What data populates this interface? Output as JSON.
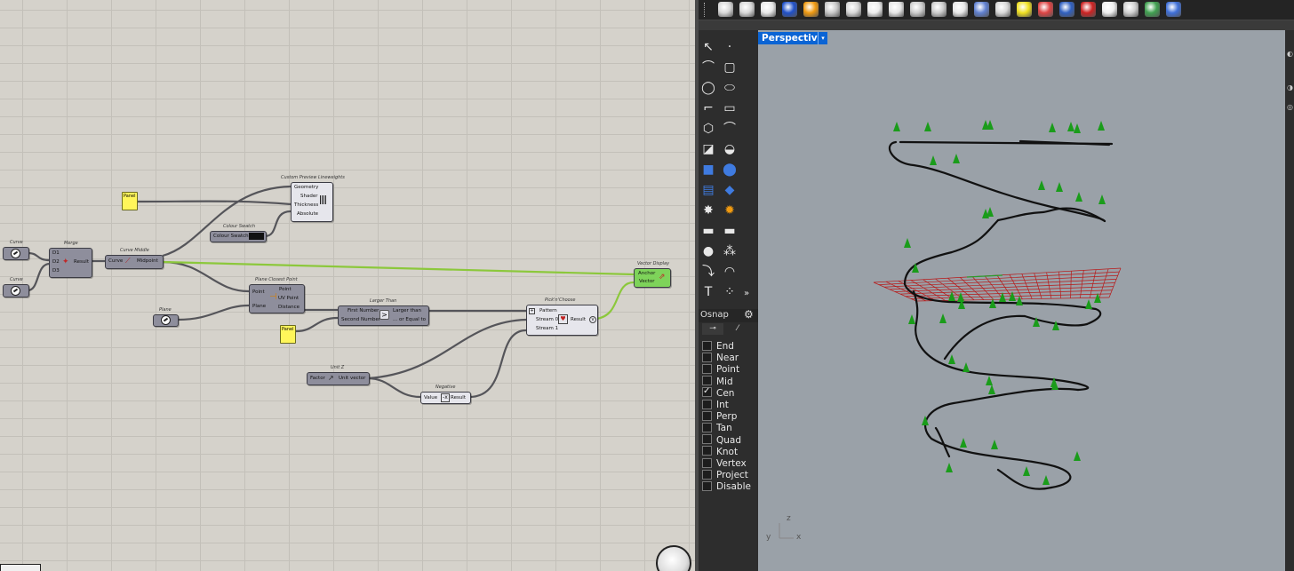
{
  "grasshopper": {
    "components": {
      "curve1": {
        "title": "Curve"
      },
      "curve2": {
        "title": "Curve"
      },
      "merge": {
        "title": "Merge",
        "inputs": [
          "D1",
          "D2",
          "D3"
        ],
        "output": "Result"
      },
      "curve_middle": {
        "title": "Curve Middle",
        "input": "Curve",
        "output": "Midpoint"
      },
      "custom_preview": {
        "title": "Custom Preview Lineweights",
        "inputs": [
          "Geometry",
          "Shader",
          "Thickness",
          "Absolute"
        ]
      },
      "colour_swatch": {
        "title": "Colour Swatch",
        "label": "Colour Swatch",
        "color": "#111111"
      },
      "panel_top": {
        "label": "Panel"
      },
      "vector_display": {
        "title": "Vector Display",
        "inputs": [
          "Anchor",
          "Vector"
        ]
      },
      "plane_closest": {
        "title": "Plane Closest Point",
        "inputs": [
          "Point",
          "Plane"
        ],
        "outputs": [
          "Point",
          "UV Point",
          "Distance"
        ]
      },
      "plane_param": {
        "title": "Plane"
      },
      "larger_than": {
        "title": "Larger Than",
        "inputs": [
          "First Number",
          "Second Number"
        ],
        "outputs": [
          "Larger than",
          "... or Equal to"
        ],
        "symbol": ">"
      },
      "panel_mid": {
        "label": "Panel"
      },
      "pick_choose": {
        "title": "Pick'n'Choose",
        "inputs": [
          "Pattern",
          "Stream 0",
          "Stream 1"
        ],
        "output": "Result"
      },
      "unit_z": {
        "title": "Unit Z",
        "input": "Factor",
        "output": "Unit vector"
      },
      "negative": {
        "title": "Negative",
        "input": "Value",
        "output": "Result"
      }
    },
    "colors": {
      "wire": "#55555a",
      "selected_wire": "#8cc83c",
      "vector_display": "#7ed35a",
      "panel": "#fff65a"
    }
  },
  "rhino": {
    "viewport": {
      "name": "Perspective",
      "background": "#9aa1a8"
    },
    "axes": {
      "z": "z",
      "y": "y",
      "x": "x"
    },
    "osnap": {
      "title": "Osnap",
      "items": [
        {
          "label": "End",
          "checked": false
        },
        {
          "label": "Near",
          "checked": false
        },
        {
          "label": "Point",
          "checked": false
        },
        {
          "label": "Mid",
          "checked": false
        },
        {
          "label": "Cen",
          "checked": true
        },
        {
          "label": "Int",
          "checked": false
        },
        {
          "label": "Perp",
          "checked": false
        },
        {
          "label": "Tan",
          "checked": false
        },
        {
          "label": "Quad",
          "checked": false
        },
        {
          "label": "Knot",
          "checked": false
        },
        {
          "label": "Vertex",
          "checked": false
        },
        {
          "label": "Project",
          "checked": false
        },
        {
          "label": "Disable",
          "checked": false
        }
      ]
    },
    "toolbar_icons": [
      "select-arrow-icon",
      "point-icon",
      "polyline-icon",
      "rectangle-icon",
      "circle-icon",
      "ellipse-icon",
      "arc-icon",
      "rect-edit-icon",
      "polygon-icon",
      "fillet-icon",
      "extrude-icon",
      "rebuild-icon",
      "box-icon",
      "spheres-icon",
      "surface-icon",
      "surface-blend-icon",
      "explode-icon",
      "boolean-icon",
      "split-icon",
      "join-icon",
      "group-icon",
      "ungroup-icon",
      "arc-tool-icon",
      "curve-tool-icon",
      "text-icon",
      "array-icon"
    ],
    "colors": {
      "arrow": "#1a9c1a",
      "cplane_grid": "#b81818",
      "curve": "#111111"
    }
  }
}
